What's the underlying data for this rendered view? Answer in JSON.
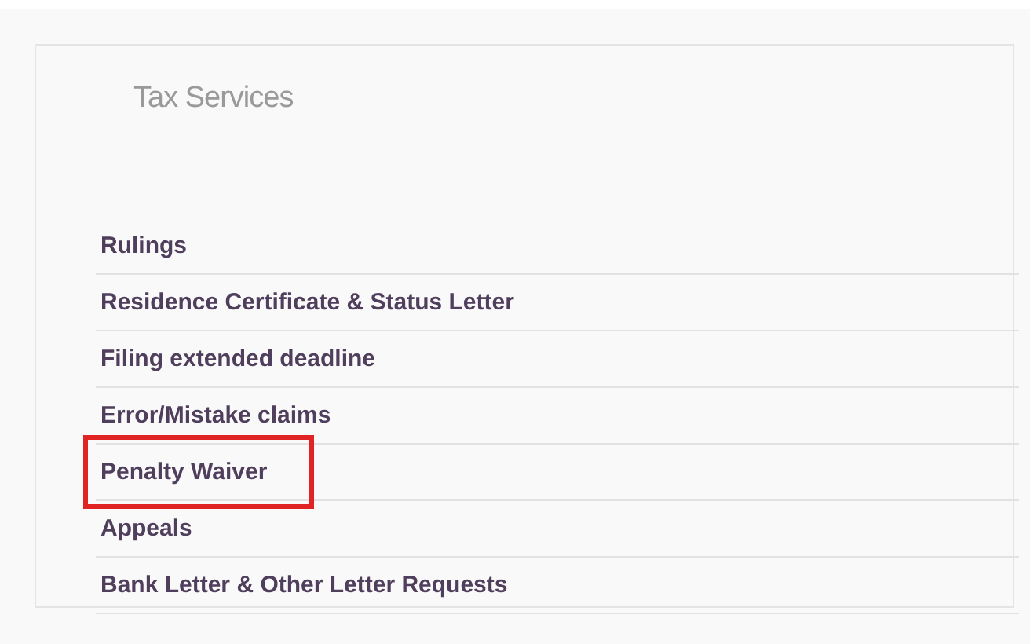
{
  "panel": {
    "title": "Tax Services"
  },
  "items": [
    {
      "label": "Rulings",
      "highlighted": false
    },
    {
      "label": "Residence Certificate & Status Letter",
      "highlighted": false
    },
    {
      "label": "Filing extended deadline",
      "highlighted": false
    },
    {
      "label": "Error/Mistake claims",
      "highlighted": false
    },
    {
      "label": "Penalty Waiver",
      "highlighted": true
    },
    {
      "label": "Appeals",
      "highlighted": false
    },
    {
      "label": "Bank Letter & Other Letter Requests",
      "highlighted": false
    }
  ]
}
